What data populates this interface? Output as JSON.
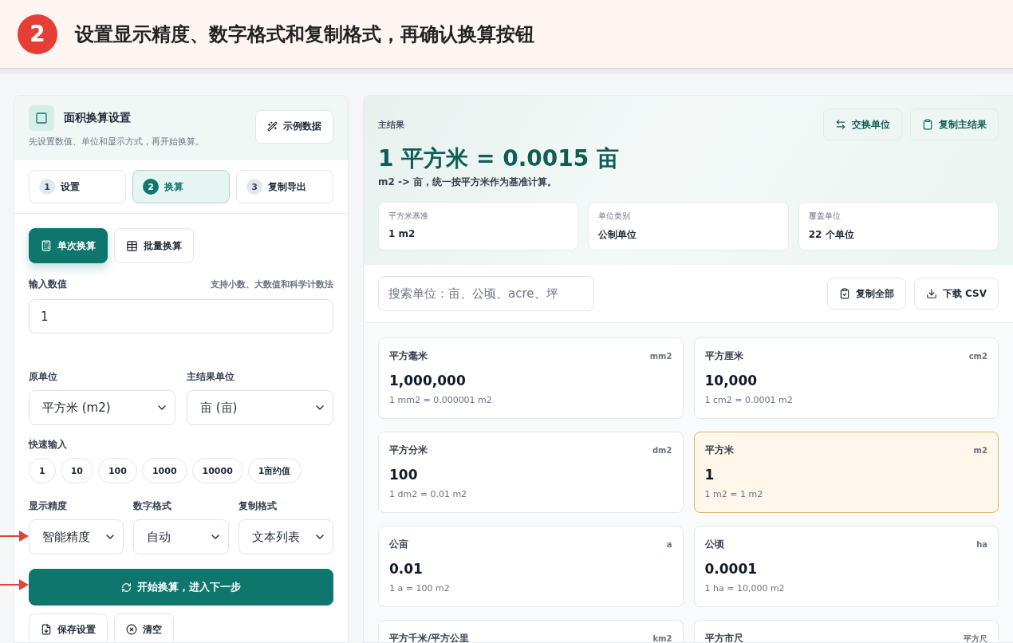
{
  "banner": {
    "step": "2",
    "title": "设置显示精度、数字格式和复制格式，再确认换算按钮"
  },
  "settings": {
    "title": "面积换算设置",
    "subtitle": "先设置数值、单位和显示方式，再开始换算。",
    "sample_button": "示例数据",
    "steps": [
      {
        "number": "1",
        "label": "设置",
        "selected": false
      },
      {
        "number": "2",
        "label": "换算",
        "selected": true
      },
      {
        "number": "3",
        "label": "复制导出",
        "selected": false
      }
    ],
    "modes": [
      {
        "label": "单次换算",
        "selected": true
      },
      {
        "label": "批量换算",
        "selected": false
      }
    ],
    "input": {
      "label": "输入数值",
      "hint": "支持小数、大数值和科学计数法",
      "value": "1"
    },
    "source_unit": {
      "label": "原单位",
      "value": "平方米 (m2)"
    },
    "target_unit": {
      "label": "主结果单位",
      "value": "亩 (亩)"
    },
    "quick": {
      "label": "快速输入",
      "values": [
        "1",
        "10",
        "100",
        "1000",
        "10000",
        "1亩约值"
      ]
    },
    "precision": {
      "label": "显示精度",
      "value": "智能精度"
    },
    "number_format": {
      "label": "数字格式",
      "value": "自动"
    },
    "copy_format": {
      "label": "复制格式",
      "value": "文本列表"
    },
    "convert_button": "开始换算，进入下一步",
    "save_button": "保存设置",
    "clear_button": "清空"
  },
  "result": {
    "label": "主结果",
    "swap_button": "交换单位",
    "copy_button": "复制主结果",
    "headline": "1 平方米 = 0.0015 亩",
    "note": "m2 -> 亩，统一按平方米作为基准计算。",
    "stats": [
      {
        "label": "平方米基准",
        "value": "1 m2"
      },
      {
        "label": "单位类别",
        "value": "公制单位"
      },
      {
        "label": "覆盖单位",
        "value": "22 个单位"
      }
    ],
    "search": {
      "placeholder": "搜索单位：亩、公顷、acre、坪"
    },
    "copy_all_button": "复制全部",
    "csv_button": "下载 CSV",
    "units": [
      {
        "name": "平方毫米",
        "symbol": "mm2",
        "value": "1,000,000",
        "formula": "1 mm2 = 0.000001 m2",
        "selected": false
      },
      {
        "name": "平方厘米",
        "symbol": "cm2",
        "value": "10,000",
        "formula": "1 cm2 = 0.0001 m2",
        "selected": false
      },
      {
        "name": "平方分米",
        "symbol": "dm2",
        "value": "100",
        "formula": "1 dm2 = 0.01 m2",
        "selected": false
      },
      {
        "name": "平方米",
        "symbol": "m2",
        "value": "1",
        "formula": "1 m2 = 1 m2",
        "selected": true
      },
      {
        "name": "公亩",
        "symbol": "a",
        "value": "0.01",
        "formula": "1 a = 100 m2",
        "selected": false
      },
      {
        "name": "公顷",
        "symbol": "ha",
        "value": "0.0001",
        "formula": "1 ha = 10,000 m2",
        "selected": false
      },
      {
        "name": "平方千米/平方公里",
        "symbol": "km2",
        "selected": false
      },
      {
        "name": "平方市尺",
        "symbol": "平方尺",
        "selected": false
      }
    ]
  }
}
